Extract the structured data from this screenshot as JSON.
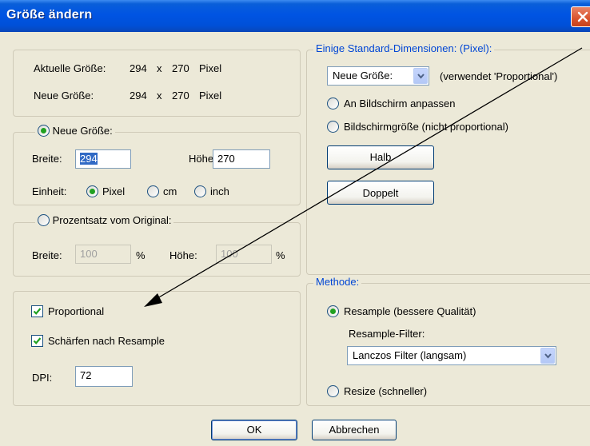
{
  "window": {
    "title": "Größe ändern",
    "close_icon": "close-x-icon"
  },
  "current_size": {
    "current_label": "Aktuelle Größe:",
    "current_w": "294",
    "current_x": "x",
    "current_h": "270",
    "current_unit": "Pixel",
    "new_label": "Neue Größe:",
    "new_w": "294",
    "new_x": "x",
    "new_h": "270",
    "new_unit": "Pixel"
  },
  "new_size": {
    "radio_label": "Neue Größe:",
    "selected": true,
    "width_label": "Breite:",
    "width_value": "294",
    "height_label": "Höhe:",
    "height_value": "270",
    "unit_label": "Einheit:",
    "units": [
      {
        "label": "Pixel",
        "selected": true
      },
      {
        "label": "cm",
        "selected": false
      },
      {
        "label": "inch",
        "selected": false
      }
    ]
  },
  "percent": {
    "radio_label": "Prozentsatz vom Original:",
    "selected": false,
    "width_label": "Breite:",
    "width_value": "100",
    "pct1": "%",
    "height_label": "Höhe:",
    "height_value": "100",
    "pct2": "%"
  },
  "options": {
    "proportional_label": "Proportional",
    "proportional_checked": true,
    "sharpen_label": "Schärfen nach Resample",
    "sharpen_checked": true,
    "dpi_label": "DPI:",
    "dpi_value": "72"
  },
  "standard": {
    "legend": "Einige Standard-Dimensionen: (Pixel):",
    "combo_value": "Neue Größe:",
    "combo_note": "(verwendet 'Proportional')",
    "fit_screen_label": "An Bildschirm anpassen",
    "screen_size_label": "Bildschirmgröße (nicht proportional)",
    "half_button": "Halb",
    "double_button": "Doppelt"
  },
  "method": {
    "legend": "Methode:",
    "resample_label": "Resample (bessere Qualität)",
    "resample_selected": true,
    "filter_label": "Resample-Filter:",
    "filter_value": "Lanczos Filter (langsam)",
    "resize_label": "Resize (schneller)",
    "resize_selected": false
  },
  "footer": {
    "ok_button": "OK",
    "cancel_button": "Abbrechen"
  },
  "colors": {
    "titlebar": "#0054e3",
    "dialog_bg": "#ece9d8",
    "group_legend_blue": "#0046d5",
    "radio_dot": "#21a121",
    "selection": "#316ac5"
  }
}
